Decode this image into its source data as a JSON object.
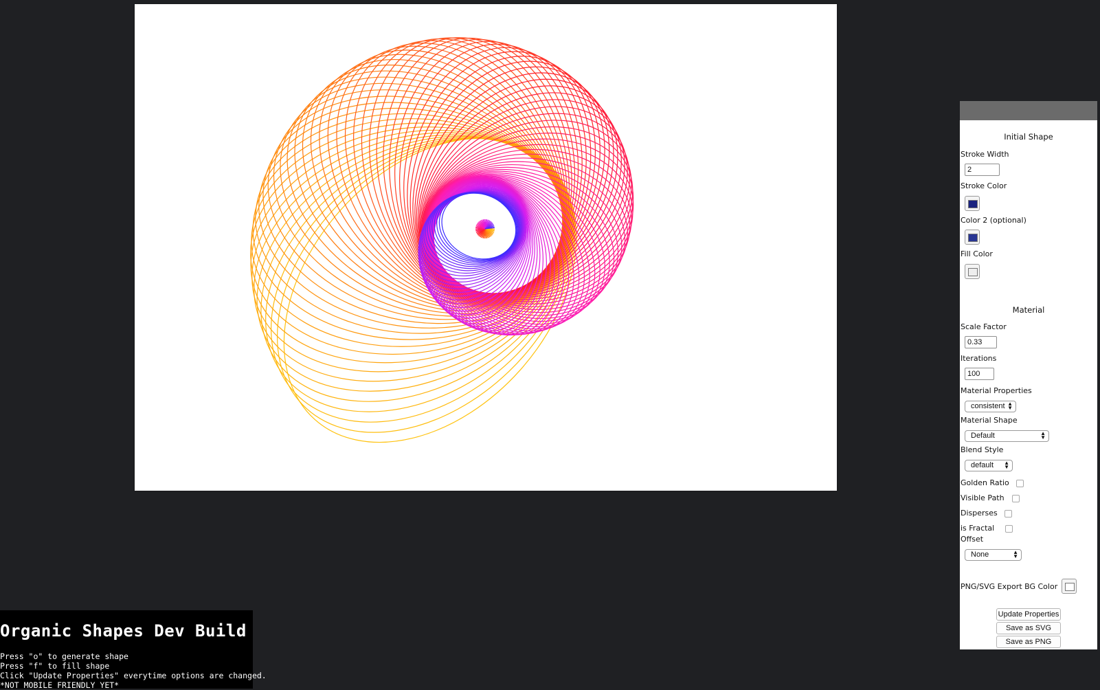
{
  "info": {
    "title": "Organic Shapes Dev Build",
    "instructions": [
      "Press \"o\" to generate shape",
      "Press \"f\" to fill shape",
      "Click \"Update Properties\" everytime options are changed.",
      "*NOT MOBILE FRIENDLY YET*"
    ]
  },
  "panel": {
    "initial_shape_title": "Initial Shape",
    "stroke_width_label": "Stroke Width",
    "stroke_width_value": "2",
    "stroke_color_label": "Stroke Color",
    "stroke_color": "#1a237e",
    "color2_label": "Color 2 (optional)",
    "color2": "#283593",
    "fill_color_label": "Fill Color",
    "fill_color": "#eeeeee",
    "material_title": "Material",
    "scale_factor_label": "Scale Factor",
    "scale_factor_value": "0.33",
    "iterations_label": "Iterations",
    "iterations_value": "100",
    "material_properties_label": "Material Properties",
    "material_properties_value": "consistent",
    "material_shape_label": "Material Shape",
    "material_shape_value": "Default",
    "blend_style_label": "Blend Style",
    "blend_style_value": "default",
    "golden_ratio_label": "Golden Ratio",
    "visible_path_label": "Visible Path",
    "disperses_label": "Disperses",
    "is_fractal_label": "is Fractal",
    "offset_label": "Offset",
    "offset_value": "None",
    "export_bg_label": "PNG/SVG Export BG Color",
    "export_bg_color": "#ffffff",
    "update_button": "Update Properties",
    "save_svg_button": "Save as SVG",
    "save_png_button": "Save as PNG"
  },
  "art": {
    "gradient_colors": [
      "#ffc20e",
      "#ff7a10",
      "#ff1a2c",
      "#ff1cae",
      "#d51ef0",
      "#3a2bff"
    ],
    "rings": 100
  }
}
